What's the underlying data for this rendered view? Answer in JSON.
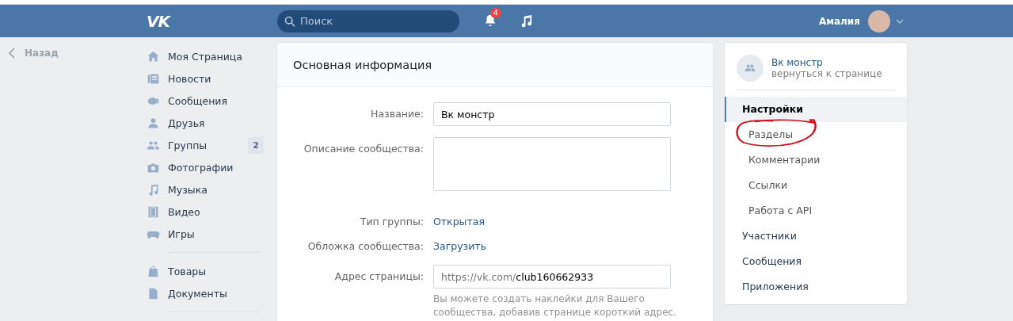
{
  "header": {
    "logo": "VK",
    "search": {
      "placeholder": "Поиск"
    },
    "notifications": {
      "count": "4"
    },
    "user": {
      "name": "Амалия"
    }
  },
  "back": {
    "label": "Назад"
  },
  "nav": {
    "sections": [
      {
        "items": [
          {
            "label": "Моя Страница",
            "kind": "home"
          },
          {
            "label": "Новости",
            "kind": "news"
          },
          {
            "label": "Сообщения",
            "kind": "messages"
          },
          {
            "label": "Друзья",
            "kind": "friends"
          },
          {
            "label": "Группы",
            "kind": "groups",
            "count": "2"
          },
          {
            "label": "Фотографии",
            "kind": "photos"
          },
          {
            "label": "Музыка",
            "kind": "music"
          },
          {
            "label": "Видео",
            "kind": "video"
          },
          {
            "label": "Игры",
            "kind": "games"
          }
        ]
      },
      {
        "items": [
          {
            "label": "Товары",
            "kind": "goods"
          },
          {
            "label": "Документы",
            "kind": "docs"
          }
        ]
      }
    ]
  },
  "main": {
    "title": "Основная информация",
    "fields": [
      {
        "kind": "input",
        "label": "Название:",
        "value": "Вк монстр"
      },
      {
        "kind": "textarea",
        "label": "Описание сообщества:"
      },
      {
        "kind": "link",
        "label": "Тип группы:",
        "value": "Открытая"
      },
      {
        "kind": "link",
        "label": "Обложка сообщества:",
        "value": "Загрузить"
      },
      {
        "kind": "address",
        "label": "Адрес страницы:",
        "prefix": "https://vk.com/",
        "value": "club160662933",
        "hint": "Вы можете создать наклейки для Вашего сообщества, добавив странице короткий адрес."
      }
    ]
  },
  "side": {
    "group": {
      "name": "Вк монстр",
      "subtitle": "вернуться к странице"
    },
    "menu": [
      {
        "label": "Настройки",
        "selected": true,
        "children": [
          {
            "label": "Разделы",
            "selected": false
          },
          {
            "label": "Комментарии",
            "selected": false
          },
          {
            "label": "Ссылки",
            "selected": false
          },
          {
            "label": "Работа с API",
            "selected": false
          }
        ]
      },
      {
        "label": "Участники",
        "selected": false
      },
      {
        "label": "Сообщения",
        "selected": false
      },
      {
        "label": "Приложения",
        "selected": false
      }
    ]
  }
}
